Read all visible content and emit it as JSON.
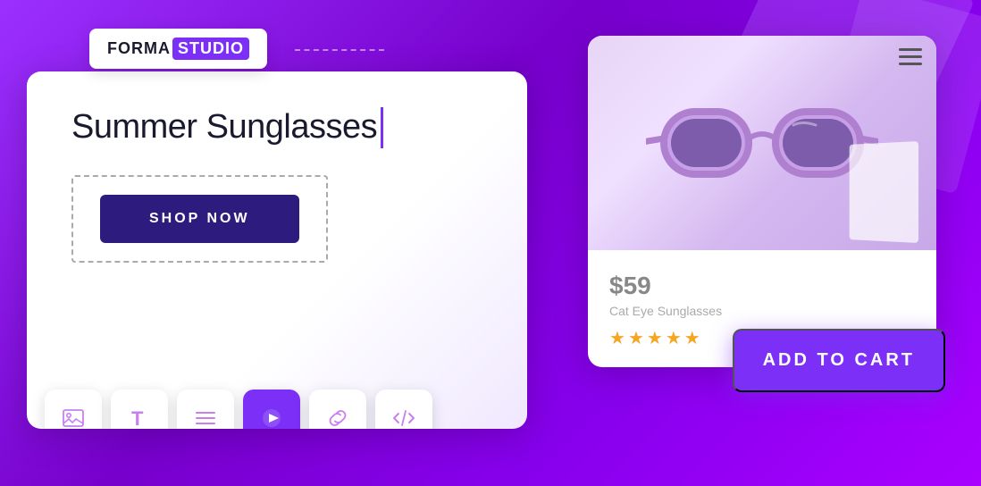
{
  "brand": {
    "name_part1": "FORMA",
    "name_part2": "STUDIO"
  },
  "editor": {
    "headline": "Summer Sunglasses",
    "shop_button_label": "SHOP NOW"
  },
  "product": {
    "price": "$59",
    "name": "Cat Eye Sunglasses",
    "stars_count": 5,
    "add_to_cart_label": "ADD TO CART"
  },
  "toolbar": {
    "icons": [
      {
        "name": "image-icon",
        "label": "Image"
      },
      {
        "name": "text-icon",
        "label": "Text"
      },
      {
        "name": "align-icon",
        "label": "Align"
      },
      {
        "name": "video-icon",
        "label": "Video"
      },
      {
        "name": "link-icon",
        "label": "Link"
      },
      {
        "name": "code-icon",
        "label": "Code"
      }
    ]
  },
  "colors": {
    "purple_primary": "#7b2ff7",
    "purple_dark": "#2d1b7e",
    "star_color": "#f5a623"
  }
}
